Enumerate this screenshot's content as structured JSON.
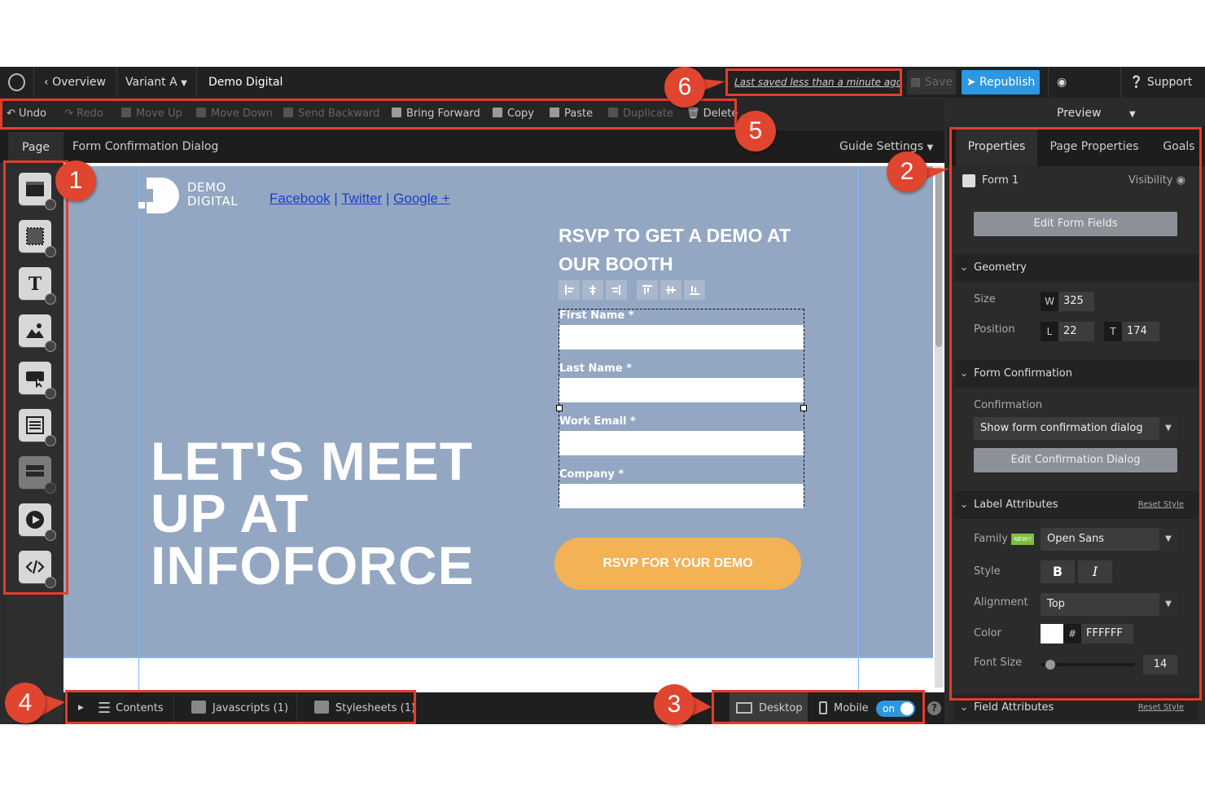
{
  "topbar": {
    "overview": "Overview",
    "variant": "Variant A",
    "page_name": "Demo Digital",
    "last_saved": "Last saved  less than a minute ago",
    "save": "Save",
    "republish": "Republish",
    "preview": "Preview",
    "support": "Support"
  },
  "editbar": {
    "undo": "Undo",
    "redo": "Redo",
    "move_up": "Move Up",
    "move_down": "Move Down",
    "send_backward": "Send Backward",
    "bring_forward": "Bring Forward",
    "copy": "Copy",
    "paste": "Paste",
    "duplicate": "Duplicate",
    "delete": "Delete"
  },
  "pagebar": {
    "page_tab": "Page",
    "context": "Form Confirmation Dialog",
    "guide_settings": "Guide Settings"
  },
  "page": {
    "brand_line1": "DEMO",
    "brand_line2": "DIGITAL",
    "social": [
      "Facebook",
      "Twitter",
      "Google +"
    ],
    "headline": [
      "LET'S MEET",
      "UP AT",
      "INFOFORCE"
    ],
    "rsvp_title": "RSVP TO GET A DEMO AT OUR BOOTH",
    "form_fields": [
      "First Name *",
      "Last Name *",
      "Work Email *",
      "Company *"
    ],
    "cta": "RSVP FOR YOUR DEMO"
  },
  "bottombar": {
    "contents": "Contents",
    "javascripts": "Javascripts",
    "javascripts_count": "(1)",
    "stylesheets": "Stylesheets",
    "stylesheets_count": "(1)",
    "desktop": "Desktop",
    "mobile": "Mobile",
    "toggle": "on",
    "help": "?"
  },
  "panel": {
    "tabs": [
      "Properties",
      "Page Properties",
      "Goals"
    ],
    "element_name": "Form 1",
    "visibility": "Visibility",
    "edit_form_fields": "Edit Form Fields",
    "geometry": {
      "title": "Geometry",
      "size_label": "Size",
      "w_prefix": "W",
      "w": "325",
      "position_label": "Position",
      "l_prefix": "L",
      "l": "22",
      "t_prefix": "T",
      "t": "174"
    },
    "form_confirmation": {
      "title": "Form Confirmation",
      "confirmation_label": "Confirmation",
      "confirmation_value": "Show form confirmation dialog",
      "edit_dialog": "Edit Confirmation Dialog"
    },
    "label_attributes": {
      "title": "Label Attributes",
      "reset": "Reset Style",
      "family_label": "Family",
      "new_badge": "NEW!!",
      "family_value": "Open Sans",
      "style_label": "Style",
      "bold": "B",
      "italic": "I",
      "alignment_label": "Alignment",
      "alignment_value": "Top",
      "color_label": "Color",
      "color_hash": "#",
      "color_value": "FFFFFF",
      "font_size_label": "Font Size",
      "font_size_value": "14",
      "font_size_fraction": 0.1
    },
    "field_attributes": {
      "title": "Field Attributes",
      "reset": "Reset Style"
    }
  },
  "annotations": [
    "1",
    "2",
    "3",
    "4",
    "5",
    "6"
  ],
  "colors": {
    "accent_red": "#e43d2a",
    "republish_blue": "#2d97e0",
    "hero_bg": "#93a7c2",
    "cta_orange": "#f3b254",
    "social_blue": "#1e3ec7"
  }
}
